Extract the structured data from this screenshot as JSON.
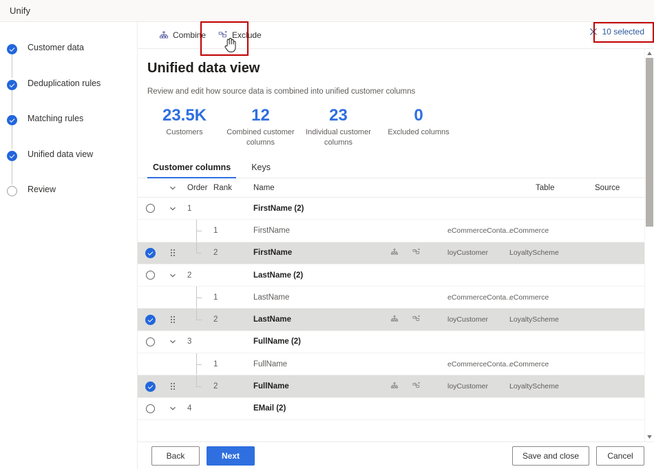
{
  "appbar": {
    "title": "Unify"
  },
  "sidebar": {
    "items": [
      {
        "label": "Customer data",
        "state": "done"
      },
      {
        "label": "Deduplication rules",
        "state": "done"
      },
      {
        "label": "Matching rules",
        "state": "done"
      },
      {
        "label": "Unified data view",
        "state": "done"
      },
      {
        "label": "Review",
        "state": "todo"
      }
    ]
  },
  "commandbar": {
    "combine_label": "Combine",
    "exclude_label": "Exclude",
    "selected_label": "10 selected",
    "combine_icon": "combine-icon",
    "exclude_icon": "exclude-icon",
    "close_icon": "close-icon"
  },
  "main": {
    "title": "Unified data view",
    "subtitle": "Review and edit how source data is combined into unified customer columns",
    "stats": [
      {
        "value": "23.5K",
        "label": "Customers"
      },
      {
        "value": "12",
        "label": "Combined customer columns"
      },
      {
        "value": "23",
        "label": "Individual customer columns"
      },
      {
        "value": "0",
        "label": "Excluded columns"
      }
    ],
    "tabs": [
      {
        "label": "Customer columns",
        "active": true
      },
      {
        "label": "Keys",
        "active": false
      }
    ],
    "table": {
      "headers": {
        "order": "Order",
        "rank": "Rank",
        "name": "Name",
        "table": "Table",
        "source": "Source"
      },
      "groups": [
        {
          "order": "1",
          "name": "FirstName (2)",
          "children": [
            {
              "rank": "1",
              "name": "FirstName",
              "table": "eCommerceConta...",
              "source": "eCommerce",
              "selected": false
            },
            {
              "rank": "2",
              "name": "FirstName",
              "table": "loyCustomer",
              "source": "LoyaltyScheme",
              "selected": true
            }
          ]
        },
        {
          "order": "2",
          "name": "LastName (2)",
          "children": [
            {
              "rank": "1",
              "name": "LastName",
              "table": "eCommerceConta...",
              "source": "eCommerce",
              "selected": false
            },
            {
              "rank": "2",
              "name": "LastName",
              "table": "loyCustomer",
              "source": "LoyaltyScheme",
              "selected": true
            }
          ]
        },
        {
          "order": "3",
          "name": "FullName (2)",
          "children": [
            {
              "rank": "1",
              "name": "FullName",
              "table": "eCommerceConta...",
              "source": "eCommerce",
              "selected": false
            },
            {
              "rank": "2",
              "name": "FullName",
              "table": "loyCustomer",
              "source": "LoyaltyScheme",
              "selected": true
            }
          ]
        },
        {
          "order": "4",
          "name": "EMail (2)",
          "children": []
        }
      ]
    }
  },
  "footer": {
    "back": "Back",
    "next": "Next",
    "save_and_close": "Save and close",
    "cancel": "Cancel"
  },
  "colors": {
    "accent": "#2f6fe0",
    "step_done": "#2266dd",
    "annotation": "#c00000",
    "row_selected": "#dededd"
  }
}
